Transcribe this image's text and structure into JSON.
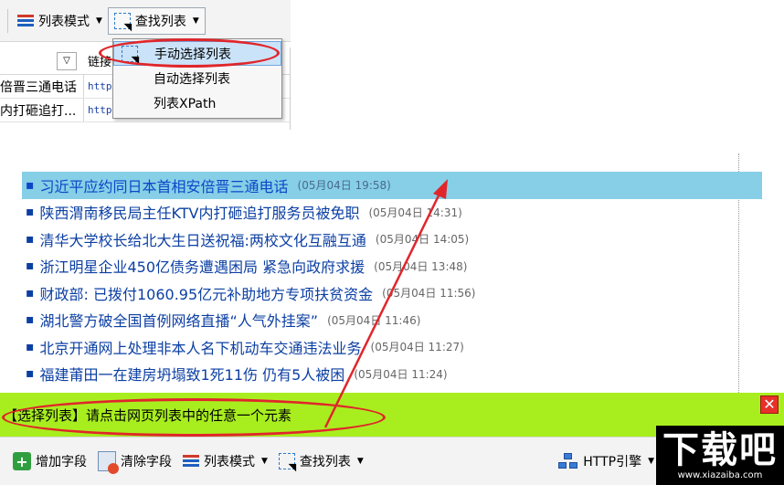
{
  "top_toolbar": {
    "list_mode_label": "列表模式",
    "find_list_label": "查找列表"
  },
  "find_menu": {
    "items": [
      {
        "label": "手动选择列表"
      },
      {
        "label": "自动选择列表"
      },
      {
        "label": "列表XPath"
      }
    ]
  },
  "grid": {
    "column_title": "链接",
    "rows": [
      {
        "text": "倍晋三通电话",
        "link": "http"
      },
      {
        "text": "内打砸追打...",
        "link": "http"
      }
    ]
  },
  "news": {
    "items": [
      {
        "title": "习近平应约同日本首相安倍晋三通电话",
        "time": "(05月04日 19:58)"
      },
      {
        "title": "陕西渭南移民局主任KTV内打砸追打服务员被免职",
        "time": "(05月04日 14:31)"
      },
      {
        "title": "清华大学校长给北大生日送祝福:两校文化互融互通",
        "time": "(05月04日 14:05)"
      },
      {
        "title": "浙江明星企业450亿债务遭遇困局 紧急向政府求援",
        "time": "(05月04日 13:48)"
      },
      {
        "title": "财政部: 已拨付1060.95亿元补助地方专项扶贫资金",
        "time": "(05月04日 11:56)"
      },
      {
        "title": "湖北警方破全国首例网络直播“人气外挂案”",
        "time": "(05月04日 11:46)"
      },
      {
        "title": "北京开通网上处理非本人名下机动车交通违法业务",
        "time": "(05月04日 11:27)"
      },
      {
        "title": "福建莆田一在建房坍塌致1死11伤 仍有5人被困",
        "time": "(05月04日 11:24)"
      }
    ]
  },
  "tipbar": {
    "message": "【选择列表】请点击网页列表中的任意一个元素"
  },
  "bottom_toolbar": {
    "add_field_label": "增加字段",
    "clear_field_label": "清除字段",
    "list_mode_label": "列表模式",
    "find_list_label": "查找列表",
    "http_label": "HTTP引擎"
  },
  "watermark": {
    "logo": "下载吧",
    "url": "www.xiazaiba.com"
  },
  "colors": {
    "highlight_row": "#86cfe7",
    "tipbar": "#a8ee1e",
    "annotation": "#e0262b",
    "link": "#0b3fa3"
  }
}
